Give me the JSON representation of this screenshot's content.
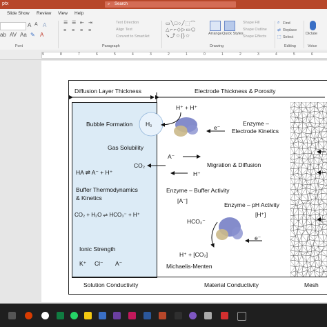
{
  "window": {
    "file_name": "ptx",
    "search_placeholder": "Search"
  },
  "tabs": [
    "Slide Show",
    "Review",
    "View",
    "Help"
  ],
  "ribbon": {
    "groups": {
      "font": "Font",
      "paragraph": "Paragraph",
      "drawing": "Drawing",
      "editing": "Editing"
    },
    "paragraph_items": [
      "Text Direction",
      "Align Text",
      "Convert to SmartArt"
    ],
    "drawing_items": [
      "Arrange",
      "Quick Styles",
      "Shape Fill",
      "Shape Outline",
      "Shape Effects"
    ],
    "editing_items": [
      "Find",
      "Replace",
      "Select"
    ],
    "dictate": "Dictate",
    "voice": "Voice"
  },
  "ruler_labels": [
    "9",
    "8",
    "7",
    "6",
    "5",
    "4",
    "3",
    "2",
    "1",
    "0",
    "1",
    "2",
    "3",
    "4",
    "5",
    "6"
  ],
  "diagram": {
    "header_left": "Diffusion Layer Thickness",
    "header_right": "Electrode Thickness & Porosity",
    "left": {
      "bubble": "Bubble Formation",
      "h2": "H₂",
      "gas": "Gas Solubility",
      "ha": "HA ⇌ A⁻ + H⁺",
      "buffer1": "Buffer Thermodynamics",
      "buffer2": "& Kinetics",
      "co2eq": "CO₂ + H₂O ⇌ HCO₃⁻ + H⁺",
      "ionic": "Ionic Strength",
      "ions": [
        "K⁺",
        "Cl⁻",
        "A⁻"
      ]
    },
    "middle": {
      "hh": "H⁺ + H⁺",
      "eminus1": "e⁻",
      "enzyme1": "Enzyme –",
      "enzyme2": "Electrode Kinetics",
      "co2": "CO₂",
      "aminus": "A⁻",
      "hplus": "H⁺",
      "migration": "Migration & Diffusion",
      "buffer_activity": "Enzyme – Buffer Activity",
      "a_conc": "[A⁻]",
      "ph_activity": "Enzyme – pH Activity",
      "h_conc": "[H⁺]",
      "hco2": "HCO₂⁻",
      "eminus2": "e⁻",
      "h_co2": "H⁺ + [CO₂]",
      "michaelis": "Michaelis-Menten"
    },
    "footer": {
      "solution": "Solution Conductivity",
      "material": "Material Conductivity",
      "mesh": "Mesh"
    }
  },
  "colors": {
    "titlebar": "#b7472a",
    "solution_fill": "#dcebf6",
    "protein_blue": "#6f78c2",
    "protein_tan": "#cbb98a"
  }
}
